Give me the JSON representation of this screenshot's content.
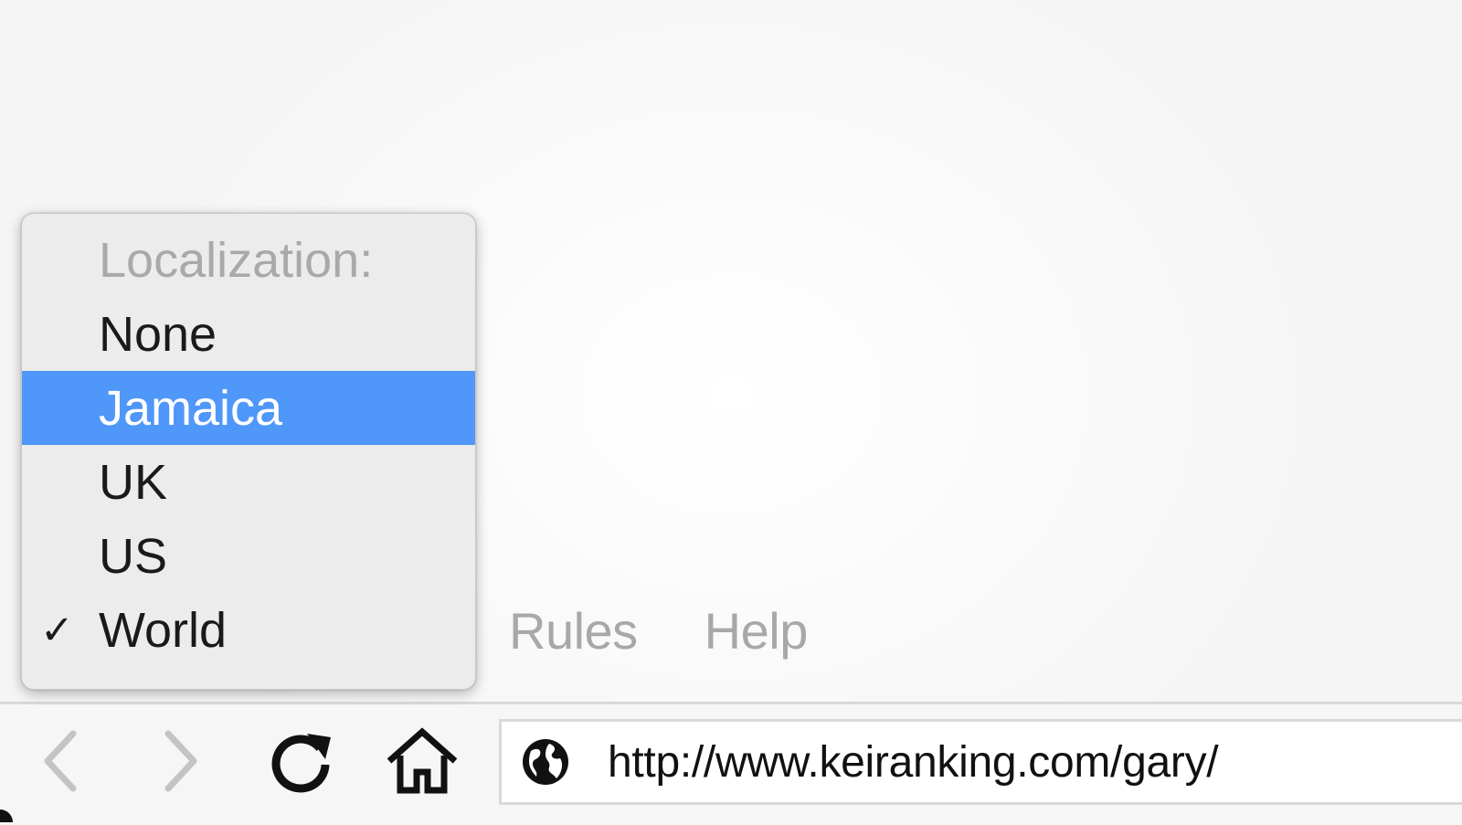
{
  "menu_bar": {
    "items": [
      {
        "label": "Rules"
      },
      {
        "label": "Help"
      }
    ]
  },
  "localization_menu": {
    "header": "Localization:",
    "options": [
      {
        "label": "None",
        "selected": false,
        "checked": false
      },
      {
        "label": "Jamaica",
        "selected": true,
        "checked": false
      },
      {
        "label": "UK",
        "selected": false,
        "checked": false
      },
      {
        "label": "US",
        "selected": false,
        "checked": false
      },
      {
        "label": "World",
        "selected": false,
        "checked": true
      }
    ],
    "check_mark": "✓",
    "highlight_color": "#4f97f9"
  },
  "toolbar": {
    "back_icon": "chevron-left-icon",
    "forward_icon": "chevron-right-icon",
    "reload_icon": "reload-icon",
    "home_icon": "home-icon",
    "url_icon": "globe-icon",
    "url": "http://www.keiranking.com/gary/"
  }
}
